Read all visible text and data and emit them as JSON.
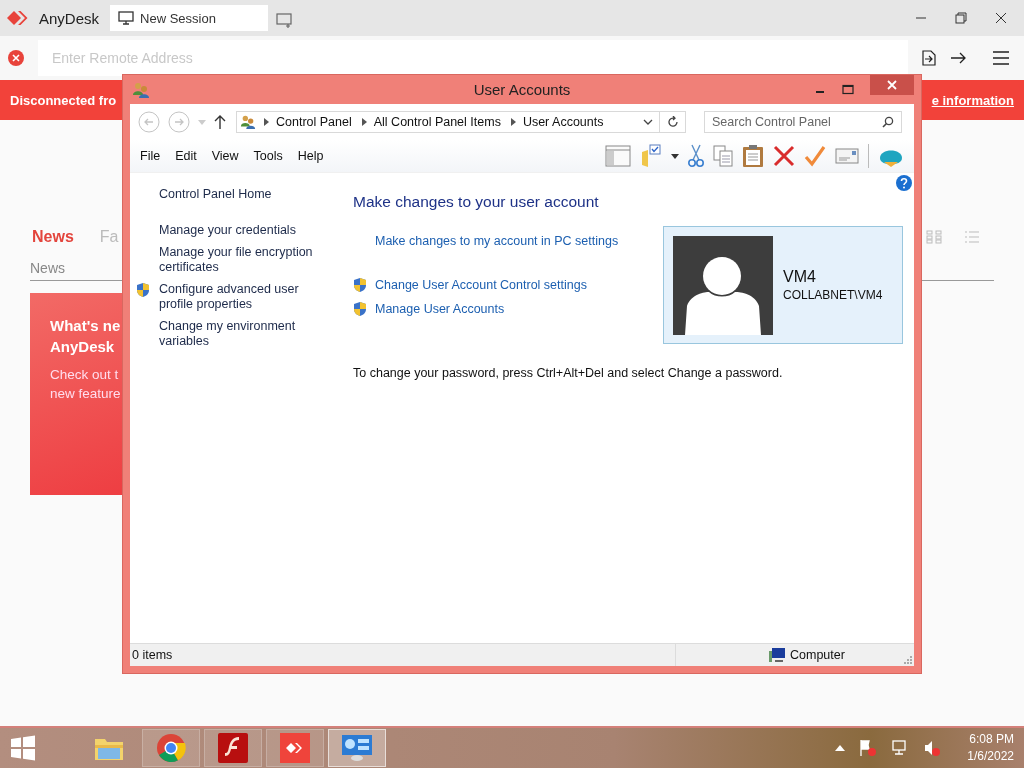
{
  "app": {
    "name": "AnyDesk",
    "tabs": [
      {
        "label": "New Session",
        "selected": true
      }
    ]
  },
  "address_bar": {
    "placeholder": "Enter Remote Address"
  },
  "banner": {
    "message": "Disconnected fro",
    "link": "e information"
  },
  "news": {
    "tabs": [
      {
        "label": "News",
        "selected": true
      },
      {
        "label": "Fa",
        "selected": false
      }
    ],
    "section": "News",
    "card": {
      "title_lines": [
        "What's ne",
        "AnyDesk"
      ],
      "body_lines": [
        "Check out t",
        "new feature"
      ]
    }
  },
  "dialog": {
    "title": "User Accounts",
    "breadcrumb": [
      "Control Panel",
      "All Control Panel Items",
      "User Accounts"
    ],
    "search": {
      "placeholder": "Search Control Panel"
    },
    "menu": [
      "File",
      "Edit",
      "View",
      "Tools",
      "Help"
    ],
    "sidebar": [
      {
        "label": "Control Panel Home",
        "shield": false
      },
      {
        "label": "Manage your credentials",
        "shield": false
      },
      {
        "label": "Manage your file encryption certificates",
        "shield": false
      },
      {
        "label": "Configure advanced user profile properties",
        "shield": true
      },
      {
        "label": "Change my environment variables",
        "shield": false
      }
    ],
    "heading": "Make changes to your user account",
    "links": [
      {
        "label": "Make changes to my account in PC settings",
        "shield": false
      },
      {
        "label": "Change User Account Control settings",
        "shield": true
      },
      {
        "label": "Manage User Accounts",
        "shield": true
      }
    ],
    "account": {
      "name": "VM4",
      "domain": "COLLABNET\\VM4"
    },
    "note": "To change your password, press Ctrl+Alt+Del and select Change a password.",
    "status": {
      "items": "0 items",
      "zone": "Computer"
    }
  },
  "taskbar": {
    "apps": [
      {
        "kind": "explorer",
        "running": false,
        "selected": false
      },
      {
        "kind": "chrome",
        "running": true,
        "selected": false
      },
      {
        "kind": "flash",
        "running": true,
        "selected": false
      },
      {
        "kind": "anydesk",
        "running": true,
        "selected": false
      },
      {
        "kind": "control-panel",
        "running": true,
        "selected": true
      }
    ],
    "clock": {
      "time": "6:08 PM",
      "date": "1/6/2022"
    }
  }
}
